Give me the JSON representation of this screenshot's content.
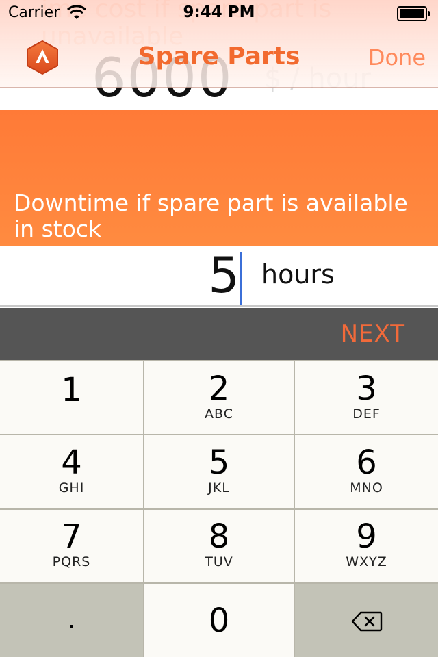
{
  "status_bar": {
    "carrier": "Carrier",
    "time": "9:44 PM",
    "wifi_icon": "wifi-icon",
    "battery_icon": "battery-icon"
  },
  "nav": {
    "title": "Spare Parts",
    "done_label": "Done",
    "logo_icon": "app-logo-icon",
    "accent_color": "#f26a2f"
  },
  "background_content": {
    "ghost_value": "6000",
    "ghost_unit": "$ / hour"
  },
  "question": {
    "text": "Downtime if spare part is available in stock",
    "band_color": "#ff7f3a"
  },
  "input": {
    "value": "5",
    "unit": "hours"
  },
  "toolbar": {
    "next_label": "NEXT",
    "color": "#555555"
  },
  "keypad": {
    "keys": [
      {
        "num": "1",
        "letters": ""
      },
      {
        "num": "2",
        "letters": "ABC"
      },
      {
        "num": "3",
        "letters": "DEF"
      },
      {
        "num": "4",
        "letters": "GHI"
      },
      {
        "num": "5",
        "letters": "JKL"
      },
      {
        "num": "6",
        "letters": "MNO"
      },
      {
        "num": "7",
        "letters": "PQRS"
      },
      {
        "num": "8",
        "letters": "TUV"
      },
      {
        "num": "9",
        "letters": "WXYZ"
      },
      {
        "num": ".",
        "letters": ""
      },
      {
        "num": "0",
        "letters": ""
      }
    ],
    "delete_icon": "backspace-icon"
  }
}
